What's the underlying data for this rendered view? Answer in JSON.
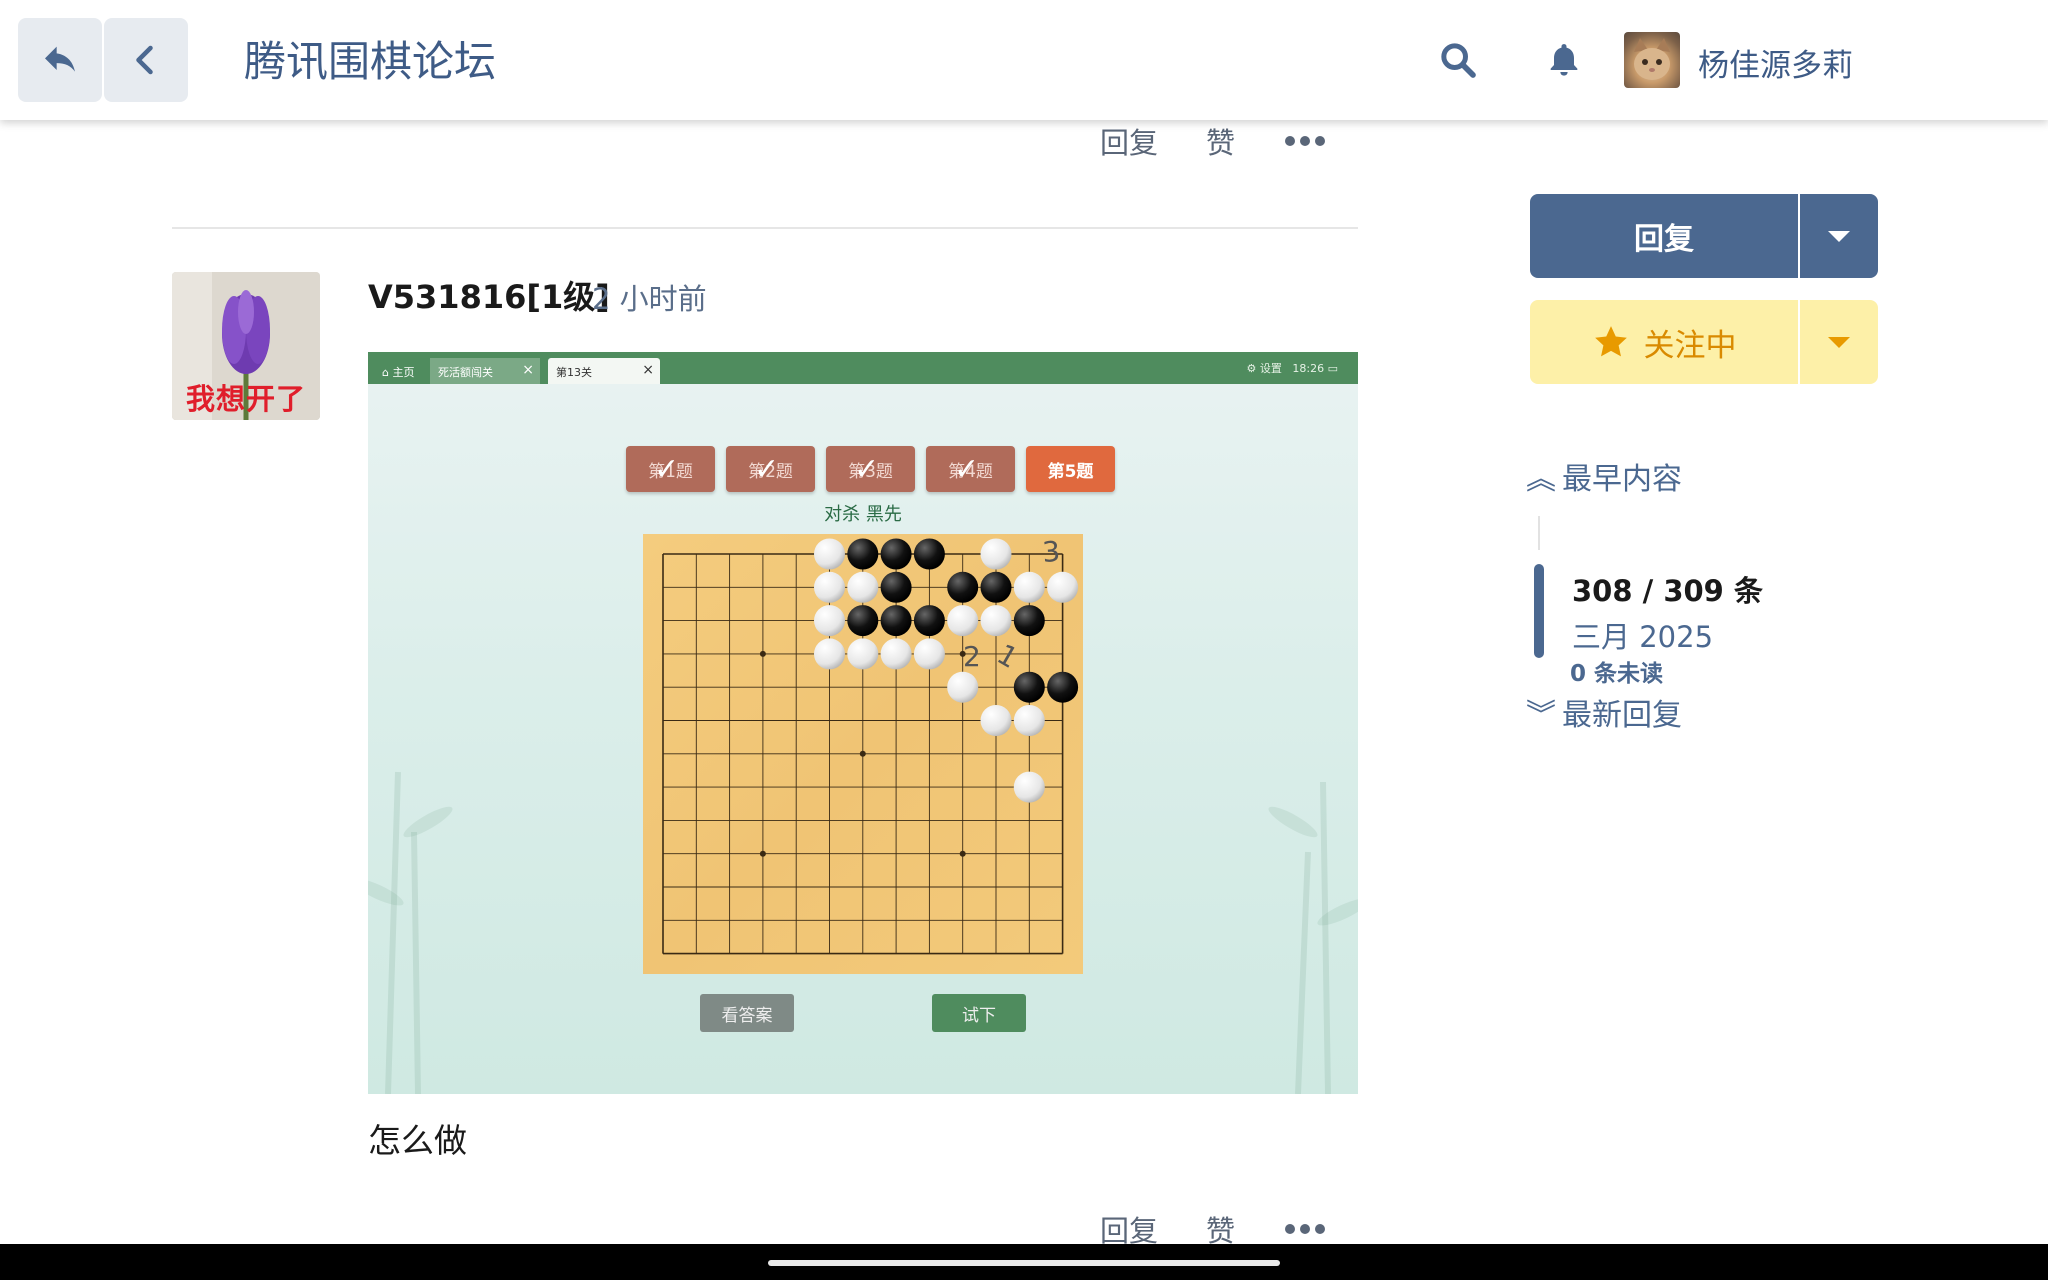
{
  "header": {
    "site_title": "腾讯围棋论坛",
    "user_name": "杨佳源多莉"
  },
  "post_actions_top": {
    "reply": "回复",
    "like": "赞"
  },
  "post": {
    "username": "V531816[1级]",
    "time": "2 小时前",
    "avatar_caption": "我想开了",
    "body": "怎么做",
    "actions": {
      "reply": "回复",
      "like": "赞"
    }
  },
  "game": {
    "tabs": [
      {
        "label": "主页"
      },
      {
        "label": "死活额闯关"
      },
      {
        "label": "第13关"
      }
    ],
    "settings_label": "设置",
    "time": "18:26",
    "question_buttons": [
      "第1题",
      "第2题",
      "第3题",
      "第4题",
      "第5题"
    ],
    "current_question": "第5题",
    "subtitle": "对杀  黑先",
    "answer_button": "看答案",
    "try_button": "试下",
    "annotations": [
      "3",
      "2",
      "1"
    ],
    "stones": {
      "black": [
        [
          6,
          0
        ],
        [
          7,
          0
        ],
        [
          8,
          0
        ],
        [
          7,
          1
        ],
        [
          9,
          1
        ],
        [
          10,
          1
        ],
        [
          6,
          2
        ],
        [
          7,
          2
        ],
        [
          8,
          2
        ],
        [
          11,
          2
        ],
        [
          11,
          4
        ],
        [
          12,
          4
        ]
      ],
      "white": [
        [
          5,
          0
        ],
        [
          10,
          0
        ],
        [
          5,
          1
        ],
        [
          6,
          1
        ],
        [
          11,
          1
        ],
        [
          12,
          1
        ],
        [
          5,
          2
        ],
        [
          9,
          2
        ],
        [
          10,
          2
        ],
        [
          5,
          3
        ],
        [
          6,
          3
        ],
        [
          7,
          3
        ],
        [
          8,
          3
        ],
        [
          9,
          4
        ],
        [
          10,
          5
        ],
        [
          11,
          5
        ],
        [
          11,
          7
        ]
      ]
    }
  },
  "sidebar": {
    "reply_button": "回复",
    "follow_button": "关注中",
    "earliest": "最早内容",
    "count": "308 / 309 条",
    "date": "三月 2025",
    "unread": "0 条未读",
    "latest": "最新回复"
  }
}
